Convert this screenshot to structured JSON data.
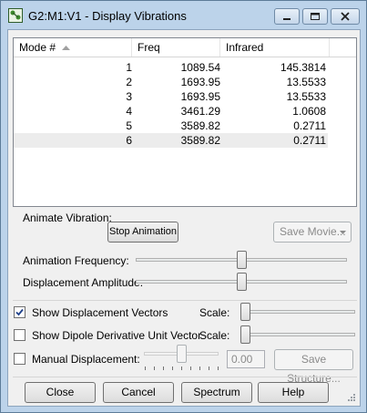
{
  "window": {
    "title": "G2:M1:V1 - Display Vibrations"
  },
  "table": {
    "columns": [
      "Mode #",
      "Freq",
      "Infrared"
    ],
    "rows": [
      {
        "mode": "1",
        "freq": "1089.54",
        "infrared": "145.3814"
      },
      {
        "mode": "2",
        "freq": "1693.95",
        "infrared": "13.5533"
      },
      {
        "mode": "3",
        "freq": "1693.95",
        "infrared": "13.5533"
      },
      {
        "mode": "4",
        "freq": "3461.29",
        "infrared": "1.0608"
      },
      {
        "mode": "5",
        "freq": "3589.82",
        "infrared": "0.2711"
      },
      {
        "mode": "6",
        "freq": "3589.82",
        "infrared": "0.2711"
      }
    ],
    "selected_row": 5
  },
  "animate": {
    "group_label": "Animate Vibration:",
    "stop_button": "Stop Animation",
    "save_movie_button": "Save Movie...",
    "frequency_label": "Animation Frequency:",
    "frequency_level": 0.5,
    "amplitude_label": "Displacement Amplitude:",
    "amplitude_level": 0.5
  },
  "options": {
    "show_vectors_label": "Show Displacement Vectors",
    "show_vectors_checked": true,
    "vectors_scale_label": "Scale:",
    "vectors_scale_level": 0.0,
    "show_dipole_label": "Show Dipole Derivative Unit Vector",
    "show_dipole_checked": false,
    "dipole_scale_label": "Scale:",
    "dipole_scale_level": 0.0,
    "manual_label": "Manual Displacement:",
    "manual_checked": false,
    "manual_value": "0.00",
    "save_structure_button": "Save Structure..."
  },
  "footer": {
    "close": "Close",
    "cancel": "Cancel",
    "spectrum": "Spectrum",
    "help": "Help"
  },
  "colors": {
    "frame": "#bcd3ea",
    "check": "#1d3f8a"
  }
}
